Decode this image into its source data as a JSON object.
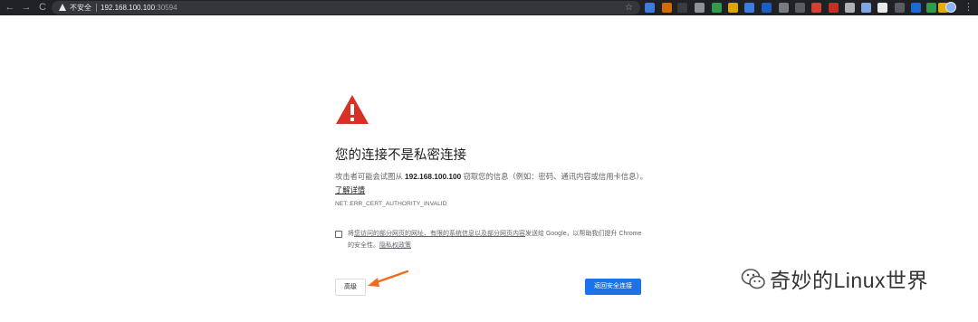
{
  "browser": {
    "nav_back": "←",
    "nav_forward": "→",
    "nav_reload": "C",
    "security_label": "不安全",
    "url_host": "192.168.100.100",
    "url_port": ":30594",
    "bookmark_icon": "star-icon",
    "extensions": [
      "#4285f4",
      "#e37400",
      "#3c4043",
      "#9aa0a6",
      "#34a853",
      "#f4b400",
      "#4285f4",
      "#1967d2",
      "#80868b",
      "#5f6368",
      "#ea4335",
      "#d93025",
      "#bdc1c6",
      "#8ab4f8",
      "#ffffff",
      "#5f6368",
      "#1a73e8",
      "#34a853",
      "#fbbc04",
      "#9aa0a6"
    ],
    "menu_icon": "⋮"
  },
  "page": {
    "alert_icon": "warning-triangle-icon",
    "heading": "您的连接不是私密连接",
    "explain_prefix": "攻击者可能会试图从 ",
    "explain_host": "192.168.100.100",
    "explain_suffix": " 窃取您的信息（例如：密码、通讯内容或信用卡信息）。",
    "learn_more": "了解详情",
    "error_code": "NET::ERR_CERT_AUTHORITY_INVALID",
    "optin_prefix": "将",
    "optin_link1": "您访问的部分网页的网址、有限的系统信息以及部分网页内容",
    "optin_middle": "发送给 Google，以帮助我们提升 Chrome 的安全性。",
    "optin_link2": "隐私权政策",
    "advanced_button": "高级",
    "back_button": "返回安全连接",
    "accent_color": "#1a73e8",
    "alert_color": "#d93025"
  },
  "overlay": {
    "arrow_color": "#f26b1d",
    "watermark_text": "奇妙的Linux世界",
    "watermark_icon": "wechat-icon"
  }
}
